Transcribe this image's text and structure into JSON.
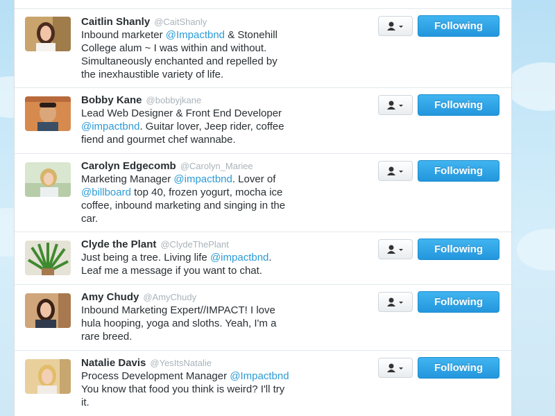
{
  "colors": {
    "accent": "#2b9bd6",
    "follow_button": "#2496dd",
    "handle_gray": "#a9b3ba",
    "text": "#292f33"
  },
  "icons": {
    "user_actions": "person-icon",
    "dropdown": "caret-down-icon"
  },
  "users": [
    {
      "name": "Caitlin Shanly",
      "handle": "@CaitShanly",
      "bio_lines": [
        [
          "Inbound marketer ",
          "@Impactbnd",
          " & Stonehill"
        ],
        [
          "College alum ~ I was within and without.",
          "",
          ""
        ],
        [
          "Simultaneously enchanted and repelled by",
          "",
          ""
        ],
        [
          "the inexhaustible variety of life.",
          "",
          ""
        ]
      ],
      "follow_label": "Following"
    },
    {
      "name": "Bobby Kane",
      "handle": "@bobbyjkane",
      "bio_lines": [
        [
          "Lead Web Designer & Front End Developer",
          "",
          ""
        ],
        [
          "",
          "@impactbnd",
          ". Guitar lover, Jeep rider, coffee"
        ],
        [
          "fiend and gourmet chef wannabe.",
          "",
          ""
        ]
      ],
      "follow_label": "Following"
    },
    {
      "name": "Carolyn Edgecomb",
      "handle": "@Carolyn_Mariee",
      "bio_lines": [
        [
          "Marketing Manager ",
          "@impactbnd",
          ". Lover of"
        ],
        [
          "",
          "@billboard",
          " top 40, frozen yogurt, mocha ice"
        ],
        [
          "coffee, inbound marketing and singing in the",
          "",
          ""
        ],
        [
          "car.",
          "",
          ""
        ]
      ],
      "follow_label": "Following"
    },
    {
      "name": "Clyde the Plant",
      "handle": "@ClydeThePlant",
      "bio_lines": [
        [
          "Just being a tree. Living life ",
          "@impactbnd",
          "."
        ],
        [
          "Leaf me a message if you want to chat.",
          "",
          ""
        ]
      ],
      "follow_label": "Following"
    },
    {
      "name": "Amy Chudy",
      "handle": "@AmyChudy",
      "bio_lines": [
        [
          "Inbound Marketing Expert//IMPACT! I love",
          "",
          ""
        ],
        [
          "hula hooping, yoga and sloths. Yeah, I'm a",
          "",
          ""
        ],
        [
          "rare breed.",
          "",
          ""
        ]
      ],
      "follow_label": "Following"
    },
    {
      "name": "Natalie Davis",
      "handle": "@YesItsNatalie",
      "bio_lines": [
        [
          "Process Development Manager ",
          "@Impactbnd",
          ""
        ],
        [
          "You know that food you think is weird? I'll try",
          "",
          ""
        ],
        [
          "it.",
          "",
          ""
        ]
      ],
      "follow_label": "Following"
    }
  ]
}
